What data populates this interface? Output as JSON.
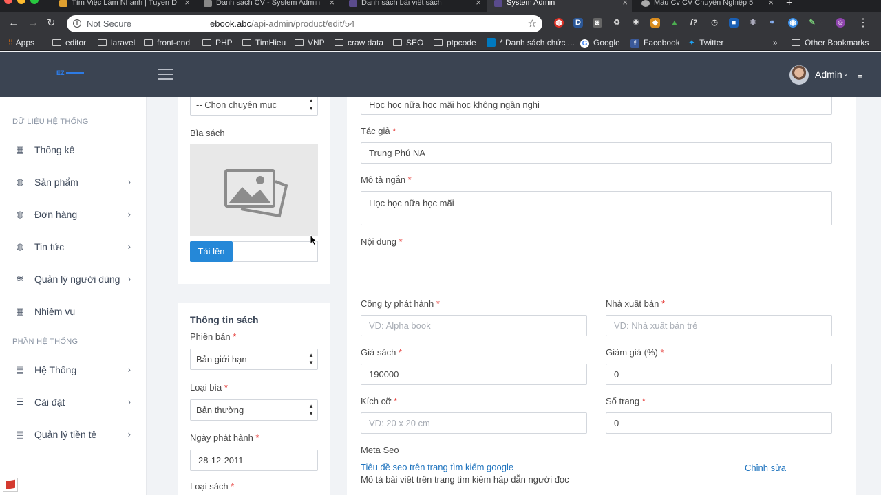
{
  "browser": {
    "tabs": [
      {
        "title": "Tìm Việc Làm Nhanh | Tuyển D",
        "active": false
      },
      {
        "title": "Danh sách CV - System Admin",
        "active": false
      },
      {
        "title": "Danh sách bài viết sách",
        "active": false
      },
      {
        "title": "System Admin",
        "active": true
      },
      {
        "title": "Mẫu Cv CV Chuyên Nghiệp 5",
        "active": false
      }
    ],
    "new_tab": "+",
    "address": {
      "security": "Not Secure",
      "host": "ebook.abc",
      "path": "/api-admin/product/edit/54"
    },
    "bookmarks": [
      {
        "label": "Apps",
        "icon": "apps-grid-icon"
      },
      {
        "label": "editor",
        "icon": "folder-icon"
      },
      {
        "label": "laravel",
        "icon": "folder-icon"
      },
      {
        "label": "front-end",
        "icon": "folder-icon"
      },
      {
        "label": "PHP",
        "icon": "folder-icon"
      },
      {
        "label": "TimHieu",
        "icon": "folder-icon"
      },
      {
        "label": "VNP",
        "icon": "folder-icon"
      },
      {
        "label": "craw data",
        "icon": "folder-icon"
      },
      {
        "label": "SEO",
        "icon": "folder-icon"
      },
      {
        "label": "ptpcode",
        "icon": "folder-icon"
      },
      {
        "label": "* Danh sách chức ...",
        "icon": "trello-icon"
      },
      {
        "label": "Google",
        "icon": "google-icon"
      },
      {
        "label": "Facebook",
        "icon": "facebook-icon"
      },
      {
        "label": "Twitter",
        "icon": "twitter-icon"
      }
    ],
    "bookmarks_overflow": "»",
    "other_bookmarks": "Other Bookmarks"
  },
  "header": {
    "logo": "EZ",
    "user": "Admin"
  },
  "sidebar": {
    "section_data": "DỮ LIỆU HỆ THỐNG",
    "section_system": "PHẦN HỆ THỐNG",
    "items": [
      {
        "label": "Thống kê",
        "icon": "dashboard-icon",
        "has_children": false
      },
      {
        "label": "Sản phẩm",
        "icon": "globe-icon",
        "has_children": true
      },
      {
        "label": "Đơn hàng",
        "icon": "globe-icon",
        "has_children": true
      },
      {
        "label": "Tin tức",
        "icon": "globe-icon",
        "has_children": true
      },
      {
        "label": "Quản lý người dùng",
        "icon": "layers-icon",
        "has_children": true
      },
      {
        "label": "Nhiệm vụ",
        "icon": "dashboard-icon",
        "has_children": false
      },
      {
        "label": "Hệ Thống",
        "icon": "document-icon",
        "has_children": true
      },
      {
        "label": "Cài đặt",
        "icon": "filter-icon",
        "has_children": true
      },
      {
        "label": "Quản lý tiền tệ",
        "icon": "document-icon",
        "has_children": true
      }
    ]
  },
  "left_panel": {
    "category_select": "-- Chọn chuyên mục",
    "cover_label": "Bìa sách",
    "upload_button": "Tải lên",
    "info_title": "Thông tin sách",
    "edition_label": "Phiên bản",
    "edition_value": "Bản giới hạn",
    "cover_type_label": "Loại bìa",
    "cover_type_value": "Bản thường",
    "release_date_label": "Ngày phát hành",
    "release_date_value": "28-12-2011",
    "book_type_label": "Loại sách"
  },
  "form": {
    "title_value": "Học học nữa học mãi học không ngần nghi",
    "author_label": "Tác giả",
    "author_value": "Trung Phú NA",
    "short_desc_label": "Mô tả ngắn",
    "short_desc_value": "Học học nữa học mãi",
    "content_label": "Nội dung",
    "publisher_company_label": "Công ty phát hành",
    "publisher_company_placeholder": "VD: Alpha book",
    "publisher_label": "Nhà xuất bản",
    "publisher_placeholder": "VD: Nhà xuất bản trẻ",
    "price_label": "Giá sách",
    "price_value": "190000",
    "discount_label": "Giảm giá (%)",
    "discount_value": "0",
    "size_label": "Kích cỡ",
    "size_placeholder": "VD: 20 x 20 cm",
    "pages_label": "Số trang",
    "pages_value": "0",
    "meta_seo_label": "Meta Seo",
    "seo_title": "Tiêu đề seo trên trang tìm kiếm google",
    "seo_desc": "Mô tả bài viết trên trang tìm kiếm hấp dẫn người đọc",
    "seo_edit": "Chỉnh sửa",
    "required_mark": "*"
  }
}
